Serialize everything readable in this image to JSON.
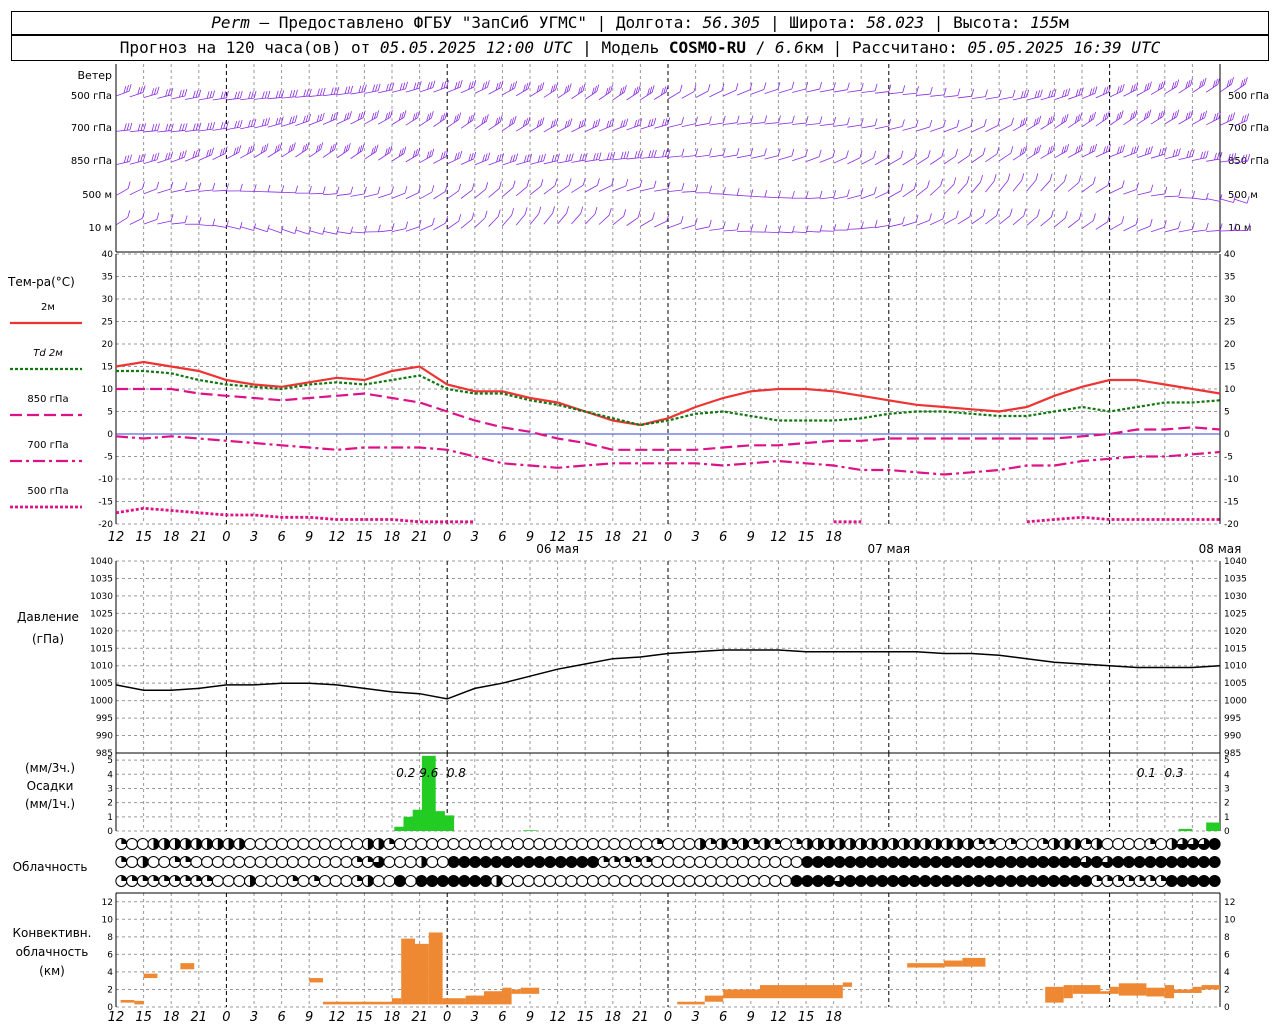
{
  "header": {
    "city": "Perm",
    "provider": "Предоставлено ФГБУ \"ЗапСиб УГМС\"",
    "lon_label": "Долгота:",
    "lon_value": "56.305",
    "lat_label": "Широта:",
    "lat_value": "58.023",
    "alt_label": "Высота:",
    "alt_value": "155",
    "alt_unit": "м",
    "forecast_label": "Прогноз на 120 часа(ов) от",
    "forecast_time": "05.05.2025 12:00 UTC",
    "model_label": "Модель",
    "model_name": "COSMO-RU",
    "model_res": "6.6",
    "model_res_unit": "км",
    "calc_label": "Рассчитано:",
    "calc_time": "05.05.2025 16:39 UTC"
  },
  "wind_panel": {
    "title": "Ветер",
    "levels": [
      "500 гПа",
      "700 гПа",
      "850 гПа",
      "500 м",
      "10 м"
    ]
  },
  "colors": {
    "wind": "#8a2be2",
    "t2m": "#ee3333",
    "td2m": "#117711",
    "mag": "#dd1188",
    "pressure": "#000000",
    "precip": "#22cc22",
    "conv": "#ee8833",
    "grid": "#999999"
  },
  "x_ticks": [
    "12",
    "15",
    "18",
    "21",
    "0",
    "3",
    "6",
    "9",
    "12",
    "15",
    "18",
    "21",
    "0",
    "3",
    "6",
    "9",
    "12",
    "15",
    "18",
    "21",
    "0",
    "3",
    "6",
    "9",
    "12",
    "15",
    "18"
  ],
  "date_labels": [
    "06 мая",
    "07 мая",
    "08 мая"
  ],
  "temp_panel": {
    "title": "Тем-ра(°C)",
    "legend": [
      "2м",
      "Td 2м",
      "850 гПа",
      "700 гПа",
      "500 гПа"
    ]
  },
  "pressure_panel": {
    "title": "Давление",
    "unit": "(гПа)"
  },
  "precip_panel": {
    "unit1": "(мм/3ч.)",
    "title": "Осадки",
    "unit2": "(мм/1ч.)"
  },
  "cloud_panel": {
    "title": "Облачность"
  },
  "conv_panel": {
    "title": "Конвективн.",
    "title2": "облачность",
    "unit": "(км)"
  },
  "chart_data": [
    {
      "type": "line",
      "name": "temperature",
      "ylim": [
        -20,
        40
      ],
      "yticks": [
        -20,
        -15,
        -10,
        -5,
        0,
        5,
        10,
        15,
        20,
        25,
        30,
        35,
        40
      ],
      "x_hours": [
        0,
        3,
        6,
        9,
        12,
        15,
        18,
        21,
        24,
        27,
        30,
        33,
        36,
        39,
        42,
        45,
        48,
        51,
        54,
        57,
        60,
        63,
        66,
        69,
        72,
        75,
        78,
        81,
        84,
        87,
        90,
        93,
        96,
        99,
        102,
        105,
        108,
        111,
        114,
        117,
        120
      ],
      "series": [
        {
          "key": "t2m",
          "values": [
            15,
            16,
            15,
            14,
            12,
            11,
            10.5,
            11.5,
            12.5,
            12,
            14,
            15,
            11,
            9.5,
            9.5,
            8,
            7,
            5,
            3,
            2,
            3.5,
            6,
            8,
            9.5,
            10,
            10,
            9.5,
            8.5,
            7.5,
            6.5,
            6,
            5.5,
            5,
            6,
            8.5,
            10.5,
            12,
            12,
            11,
            10,
            9
          ]
        },
        {
          "key": "td2m",
          "values": [
            14,
            14,
            13.5,
            12,
            11,
            10.5,
            10,
            11,
            11.5,
            11,
            12,
            13,
            10,
            9,
            9,
            7.5,
            6.5,
            5,
            3.5,
            2,
            3,
            4.5,
            5,
            4,
            3,
            3,
            3,
            3.5,
            4.5,
            5,
            5,
            4.5,
            4,
            4,
            5,
            6,
            5,
            6,
            7,
            7,
            7.5
          ]
        },
        {
          "key": "t850",
          "values": [
            10,
            10,
            10,
            9,
            8.5,
            8,
            7.5,
            8,
            8.5,
            9,
            8,
            7,
            5,
            3,
            1.5,
            0.5,
            -1,
            -2,
            -3.5,
            -3.5,
            -3.5,
            -3.5,
            -3,
            -2.5,
            -2.5,
            -2,
            -1.5,
            -1.5,
            -1,
            -1,
            -1,
            -1,
            -1,
            -1,
            -1,
            -0.5,
            0,
            1,
            1,
            1.5,
            1
          ]
        },
        {
          "key": "t700",
          "values": [
            -0.5,
            -1,
            -0.5,
            -1,
            -1.5,
            -2,
            -2.5,
            -3,
            -3.5,
            -3,
            -3,
            -3,
            -3.5,
            -5,
            -6.5,
            -7,
            -7.5,
            -7,
            -6.5,
            -6.5,
            -6.5,
            -6.5,
            -7,
            -6.5,
            -6,
            -6.5,
            -7,
            -8,
            -8,
            -8.5,
            -9,
            -8.5,
            -8,
            -7,
            -7,
            -6,
            -5.5,
            -5,
            -5,
            -4.5,
            -4
          ]
        },
        {
          "key": "t500",
          "values": [
            -17.5,
            -16.5,
            -17,
            -17.5,
            -18,
            -18,
            -18.5,
            -18.5,
            -19,
            -19,
            -19,
            -19.5,
            -19.5,
            -19.5,
            null,
            null,
            null,
            null,
            null,
            null,
            null,
            null,
            null,
            null,
            null,
            null,
            -19.5,
            -19.5,
            null,
            null,
            null,
            null,
            null,
            -19.5,
            -19,
            -18.5,
            -19,
            -19,
            -19,
            -19,
            -19
          ]
        }
      ]
    },
    {
      "type": "line",
      "name": "pressure",
      "ylim": [
        985,
        1040
      ],
      "yticks": [
        985,
        990,
        995,
        1000,
        1005,
        1010,
        1015,
        1020,
        1025,
        1030,
        1035,
        1040
      ],
      "x_hours": [
        0,
        3,
        6,
        9,
        12,
        15,
        18,
        21,
        24,
        27,
        30,
        33,
        36,
        39,
        42,
        45,
        48,
        51,
        54,
        57,
        60,
        63,
        66,
        69,
        72,
        75,
        78,
        81,
        84,
        87,
        90,
        93,
        96,
        99,
        102,
        105,
        108,
        111,
        114,
        117,
        120
      ],
      "values": [
        1004.5,
        1003,
        1003,
        1003.5,
        1004.5,
        1004.5,
        1005,
        1005,
        1004.5,
        1003.5,
        1002.5,
        1002,
        1000.5,
        1003.5,
        1005,
        1007,
        1009,
        1010.5,
        1012,
        1012.5,
        1013.5,
        1014,
        1014.5,
        1014.5,
        1014.5,
        1014,
        1014,
        1014,
        1014,
        1014,
        1013.5,
        1013.5,
        1013,
        1012,
        1011,
        1010.5,
        1010,
        1009.5,
        1009.5,
        1009.5,
        1010
      ]
    },
    {
      "type": "bar",
      "name": "precipitation",
      "ylim": [
        0,
        5.5
      ],
      "yticks": [
        0,
        1,
        2,
        3,
        4,
        5
      ],
      "x_hours": [
        31,
        32,
        33,
        34,
        35,
        36,
        45
      ],
      "values": [
        0.3,
        1,
        1.5,
        5.3,
        1.4,
        1.1,
        0.05
      ],
      "extra": [
        {
          "h": 117,
          "v": 0.15
        },
        {
          "h": 120,
          "v": 0.6
        }
      ],
      "labels": [
        {
          "h": 31.5,
          "text": "0.2"
        },
        {
          "h": 34,
          "text": "9.6"
        },
        {
          "h": 37,
          "text": "0.8"
        },
        {
          "h": 112,
          "text": "0.1"
        },
        {
          "h": 115,
          "text": "0.3"
        }
      ]
    },
    {
      "type": "bar",
      "name": "convective_cloud",
      "ylim": [
        0,
        13
      ],
      "yticks": [
        0,
        2,
        4,
        6,
        8,
        10,
        12
      ],
      "bars": [
        {
          "h0": 0.5,
          "h1": 2,
          "b": 0.5,
          "t": 0.8
        },
        {
          "h0": 2,
          "h1": 3,
          "b": 0.3,
          "t": 0.7
        },
        {
          "h0": 3,
          "h1": 4.5,
          "b": 3.3,
          "t": 3.8
        },
        {
          "h0": 7,
          "h1": 8.5,
          "b": 4.3,
          "t": 5
        },
        {
          "h0": 21,
          "h1": 22.5,
          "b": 2.8,
          "t": 3.3
        },
        {
          "h0": 22.5,
          "h1": 30,
          "b": 0.3,
          "t": 0.6
        },
        {
          "h0": 30,
          "h1": 31,
          "b": 0.3,
          "t": 1
        },
        {
          "h0": 31,
          "h1": 32.5,
          "b": 0.3,
          "t": 7.8
        },
        {
          "h0": 32.5,
          "h1": 34,
          "b": 0.3,
          "t": 7.2
        },
        {
          "h0": 34,
          "h1": 35.5,
          "b": 0.3,
          "t": 8.5
        },
        {
          "h0": 35.5,
          "h1": 38,
          "b": 0.3,
          "t": 1
        },
        {
          "h0": 38,
          "h1": 40,
          "b": 0.3,
          "t": 1.3
        },
        {
          "h0": 40,
          "h1": 42,
          "b": 0.3,
          "t": 1.8
        },
        {
          "h0": 42,
          "h1": 43,
          "b": 0.3,
          "t": 2.2
        },
        {
          "h0": 43,
          "h1": 44,
          "b": 1.5,
          "t": 2
        },
        {
          "h0": 44,
          "h1": 46,
          "b": 1.5,
          "t": 2.2
        },
        {
          "h0": 61,
          "h1": 64,
          "b": 0.3,
          "t": 0.6
        },
        {
          "h0": 64,
          "h1": 66,
          "b": 0.6,
          "t": 1.3
        },
        {
          "h0": 66,
          "h1": 70,
          "b": 1,
          "t": 2
        },
        {
          "h0": 70,
          "h1": 79,
          "b": 1,
          "t": 2.5
        },
        {
          "h0": 79,
          "h1": 80,
          "b": 2.3,
          "t": 2.8
        },
        {
          "h0": 86,
          "h1": 90,
          "b": 4.5,
          "t": 5
        },
        {
          "h0": 90,
          "h1": 92,
          "b": 4.6,
          "t": 5.3
        },
        {
          "h0": 92,
          "h1": 94.5,
          "b": 4.6,
          "t": 5.6
        },
        {
          "h0": 101,
          "h1": 103,
          "b": 0.5,
          "t": 2.3
        },
        {
          "h0": 103,
          "h1": 104,
          "b": 1,
          "t": 2.5
        },
        {
          "h0": 104,
          "h1": 107,
          "b": 1.5,
          "t": 2.5
        },
        {
          "h0": 107,
          "h1": 108,
          "b": 1.5,
          "t": 1.8
        },
        {
          "h0": 108,
          "h1": 109,
          "b": 1.5,
          "t": 2.3
        },
        {
          "h0": 109,
          "h1": 112,
          "b": 1.3,
          "t": 2.7
        },
        {
          "h0": 112,
          "h1": 114,
          "b": 1.2,
          "t": 2.2
        },
        {
          "h0": 114,
          "h1": 115,
          "b": 1,
          "t": 2.5
        },
        {
          "h0": 115,
          "h1": 117,
          "b": 1.6,
          "t": 2
        },
        {
          "h0": 117,
          "h1": 118,
          "b": 1.6,
          "t": 2.3
        },
        {
          "h0": 118,
          "h1": 120,
          "b": 2,
          "t": 2.5
        }
      ]
    },
    {
      "type": "table",
      "name": "cloud_cover",
      "rows": [
        "1002222222220000000000022100000000000000000000000010002121212101222222222222222211010012221200001023334",
        "1020011000000000000000113000200444444444444441111100000000000000444444444444444444444444443434444444444",
        "1111111110002000101000120040444444420000000000000000000000000004444344444444444444444444444111111144444"
      ]
    }
  ]
}
